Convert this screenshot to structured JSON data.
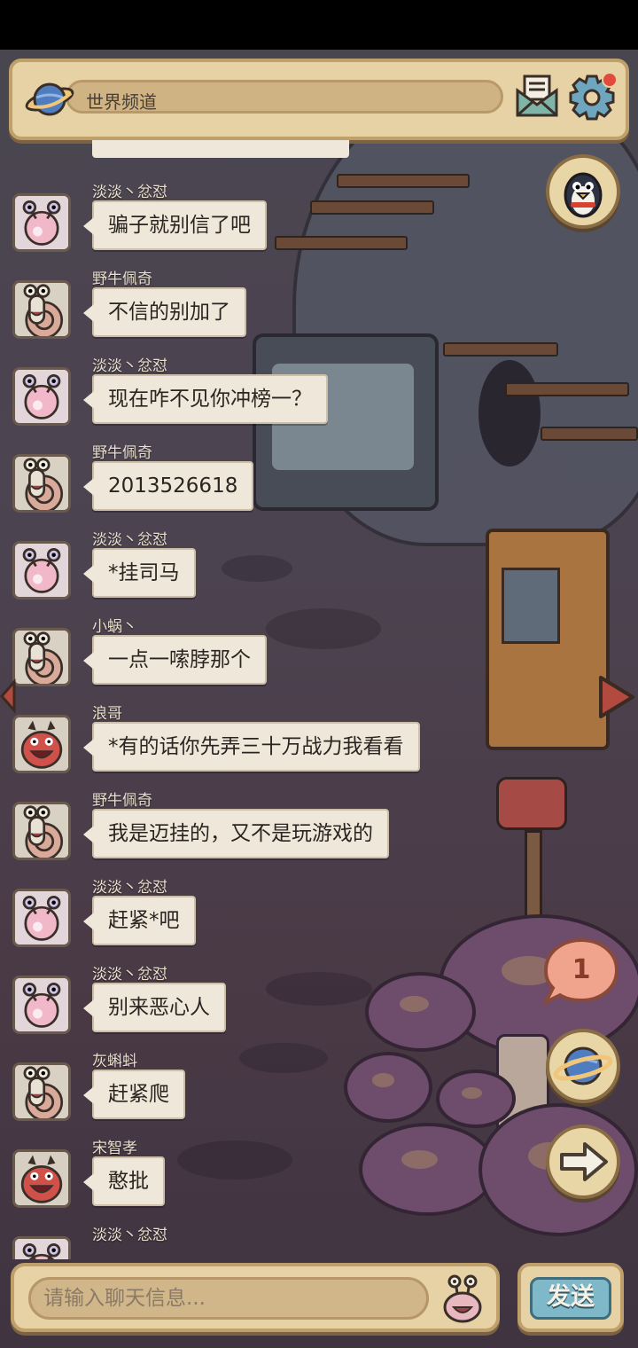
{
  "header": {
    "channel_title": "世界频道",
    "icons": [
      "planet-icon",
      "mail-icon",
      "gear-icon"
    ],
    "settings_badge": true
  },
  "messages": [
    {
      "username": "淡淡丶忿怼",
      "text": "骗子就别信了吧",
      "avatar": "pink-snail"
    },
    {
      "username": "野牛佩奇",
      "text": "不信的别加了",
      "avatar": "snail"
    },
    {
      "username": "淡淡丶忿怼",
      "text": "现在咋不见你冲榜一？",
      "avatar": "pink-snail"
    },
    {
      "username": "野牛佩奇",
      "text": "2013526618",
      "avatar": "snail"
    },
    {
      "username": "淡淡丶忿怼",
      "text": "*挂司马",
      "avatar": "pink-snail"
    },
    {
      "username": "小蜗丶",
      "text": "一点一嗦脖那个",
      "avatar": "snail"
    },
    {
      "username": "浪哥",
      "text": "*有的话你先弄三十万战力我看看",
      "avatar": "red-monster"
    },
    {
      "username": "野牛佩奇",
      "text": "我是迈挂的，又不是玩游戏的",
      "avatar": "snail"
    },
    {
      "username": "淡淡丶忿怼",
      "text": "赶紧*吧",
      "avatar": "pink-snail"
    },
    {
      "username": "淡淡丶忿怼",
      "text": "别来恶心人",
      "avatar": "pink-snail"
    },
    {
      "username": "灰蝌蚪",
      "text": "赶紧爬",
      "avatar": "snail"
    },
    {
      "username": "宋智孝",
      "text": "憨批",
      "avatar": "red-monster"
    },
    {
      "username": "淡淡丶忿怼",
      "text": "",
      "avatar": "pink-snail"
    }
  ],
  "side_buttons": {
    "notification_count": "1",
    "icons": [
      "penguin-icon",
      "planet-icon",
      "arrow-right-icon"
    ]
  },
  "input": {
    "placeholder": "请输入聊天信息...",
    "send_label": "发送",
    "emoji_icon": "snail-face-icon"
  },
  "colors": {
    "panel": "#e6d2a5",
    "panel_border": "#bfa06a",
    "bubble": "#efe7d9",
    "send_button": "#7fb9c9"
  }
}
